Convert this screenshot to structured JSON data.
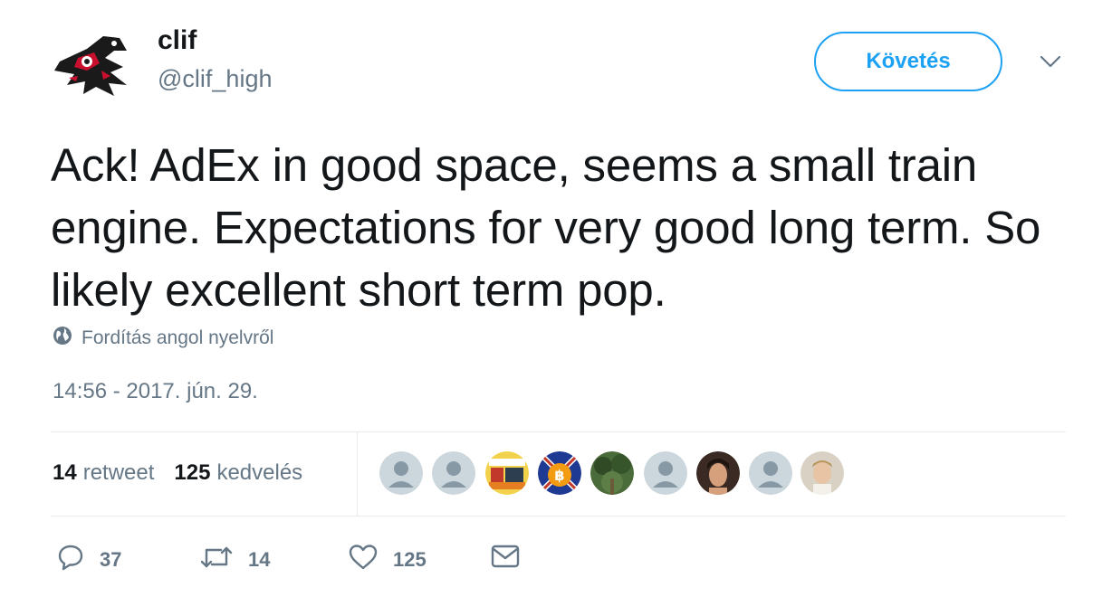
{
  "user": {
    "name": "clif",
    "handle": "@clif_high"
  },
  "follow_label": "Követés",
  "tweet": {
    "text": "Ack! AdEx in good space, seems a small train engine. Expectations for very good long term. So likely excellent short term pop.",
    "translate_label": "Fordítás angol nyelvről",
    "timestamp": "14:56 - 2017. jún. 29."
  },
  "stats": {
    "retweet_count": "14",
    "retweet_label": "retweet",
    "like_count": "125",
    "like_label": "kedvelés"
  },
  "likers": [
    "default-avatar",
    "default-avatar",
    "photo-avatar",
    "bitcoin-avatar",
    "forest-avatar",
    "default-avatar",
    "woman-avatar",
    "default-avatar",
    "man-avatar"
  ],
  "actions": {
    "reply_count": "37",
    "retweet_count": "14",
    "like_count": "125"
  },
  "colors": {
    "accent": "#1da1f2",
    "secondary_text": "#657786",
    "divider": "#e6ecf0"
  }
}
